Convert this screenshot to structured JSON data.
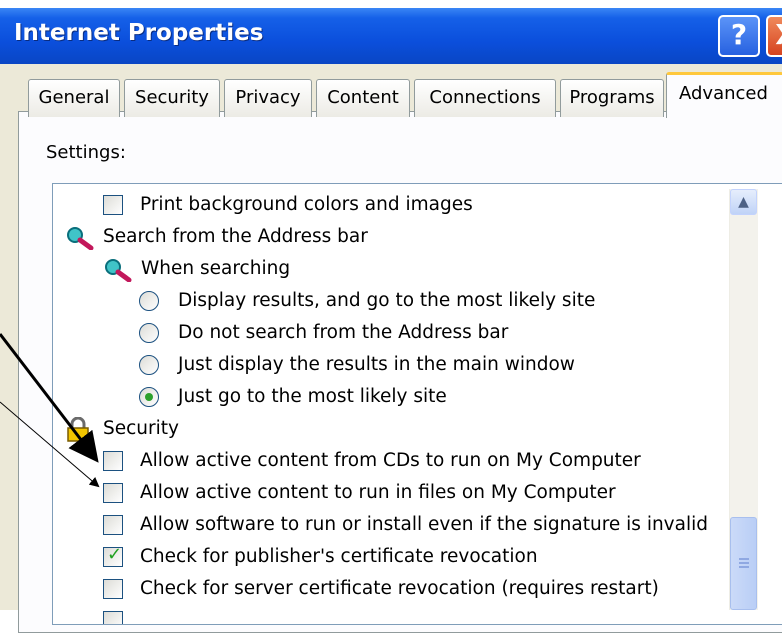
{
  "window": {
    "title": "Internet Properties",
    "help_label": "?",
    "close_label": "X"
  },
  "tabs": [
    {
      "label": "General"
    },
    {
      "label": "Security"
    },
    {
      "label": "Privacy"
    },
    {
      "label": "Content"
    },
    {
      "label": "Connections"
    },
    {
      "label": "Programs"
    },
    {
      "label": "Advanced",
      "active": true
    }
  ],
  "settings_label": "Settings:",
  "settings": [
    {
      "kind": "checkbox",
      "label": "Print background colors and images",
      "checked": false
    },
    {
      "kind": "group-icon",
      "icon": "magnifier-icon",
      "label": "Search from the Address bar"
    },
    {
      "kind": "subgroup-icon",
      "icon": "magnifier-icon",
      "label": "When searching"
    },
    {
      "kind": "radio",
      "label": "Display results, and go to the most likely site",
      "selected": false
    },
    {
      "kind": "radio",
      "label": "Do not search from the Address bar",
      "selected": false
    },
    {
      "kind": "radio",
      "label": "Just display the results in the main window",
      "selected": false
    },
    {
      "kind": "radio",
      "label": "Just go to the most likely site",
      "selected": true
    },
    {
      "kind": "group-icon",
      "icon": "padlock-icon",
      "label": "Security"
    },
    {
      "kind": "checkbox",
      "label": "Allow active content from CDs to run on My Computer",
      "checked": false
    },
    {
      "kind": "checkbox",
      "label": "Allow active content to run in files on My Computer",
      "checked": false
    },
    {
      "kind": "checkbox",
      "label": "Allow software to run or install even if the signature is invalid",
      "checked": false
    },
    {
      "kind": "checkbox",
      "label": "Check for publisher's certificate revocation",
      "checked": true
    },
    {
      "kind": "checkbox",
      "label": "Check for server certificate revocation (requires restart)",
      "checked": false
    }
  ],
  "colors": {
    "titlebar": "#0b4fdc",
    "active_tab_accent": "#ffc83c",
    "check_mark": "#21a121",
    "radio_dot": "#2ca02c"
  }
}
